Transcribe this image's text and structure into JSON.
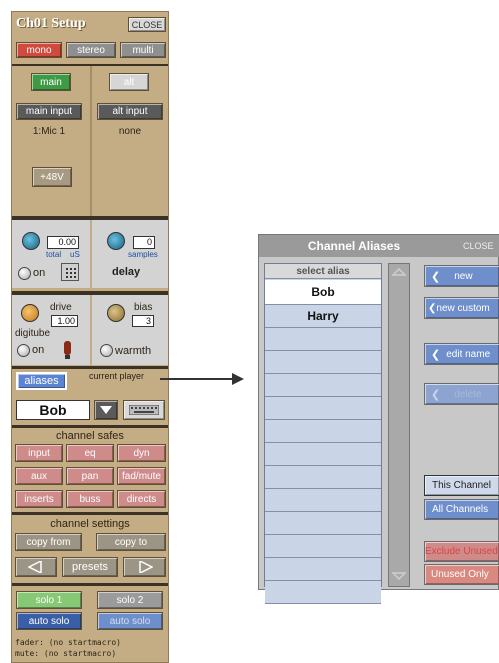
{
  "setup": {
    "title": "Ch01 Setup",
    "close": "CLOSE",
    "mode_buttons": [
      "mono",
      "stereo",
      "multi"
    ],
    "main_button": "main",
    "alt_button": "alt",
    "main_input_label": "main input",
    "alt_input_label": "alt input",
    "main_input_value": "1:Mic 1",
    "alt_input_value": "none",
    "phantom": "+48V",
    "delay": {
      "value": "0.00",
      "unit_left": "total",
      "unit_right": "uS",
      "samples": "0",
      "samples_label": "samples",
      "label": "delay",
      "on": "on"
    },
    "digitube": {
      "drive_label": "drive",
      "drive_value": "1.00",
      "bias_label": "bias",
      "bias_value": "3",
      "name": "digitube",
      "on": "on",
      "warmth": "warmth"
    },
    "aliases_button": "aliases",
    "current_player_label": "current player",
    "current_alias": "Bob",
    "channel_safes_label": "channel safes",
    "safes": [
      "input",
      "eq",
      "dyn",
      "aux",
      "pan",
      "fad/mute",
      "inserts",
      "buss",
      "directs"
    ],
    "channel_settings_label": "channel settings",
    "copy_from": "copy from",
    "copy_to": "copy to",
    "presets": "presets",
    "solo1": "solo 1",
    "solo2": "solo 2",
    "auto_solo_1": "auto solo",
    "auto_solo_2": "auto solo",
    "fader_text": "fader: (no startmacro)",
    "mute_text": "mute: (no startmacro)"
  },
  "aliases": {
    "title": "Channel Aliases",
    "close": "CLOSE",
    "header": "select alias",
    "rows": [
      "Bob",
      "Harry",
      "",
      "",
      "",
      "",
      "",
      "",
      "",
      "",
      "",
      "",
      "",
      ""
    ],
    "buttons": {
      "new": "new",
      "new_custom": "new custom",
      "edit_name": "edit name",
      "delete": "delete",
      "this_channel": "This Channel",
      "all_channels": "All Channels",
      "exclude_unused": "Exclude Unused",
      "unused_only": "Unused Only"
    }
  },
  "colors": {
    "panel": "#c4ad85",
    "red": "#d04a3e",
    "green": "#3f9a45",
    "blue": "#3a5fa8"
  }
}
